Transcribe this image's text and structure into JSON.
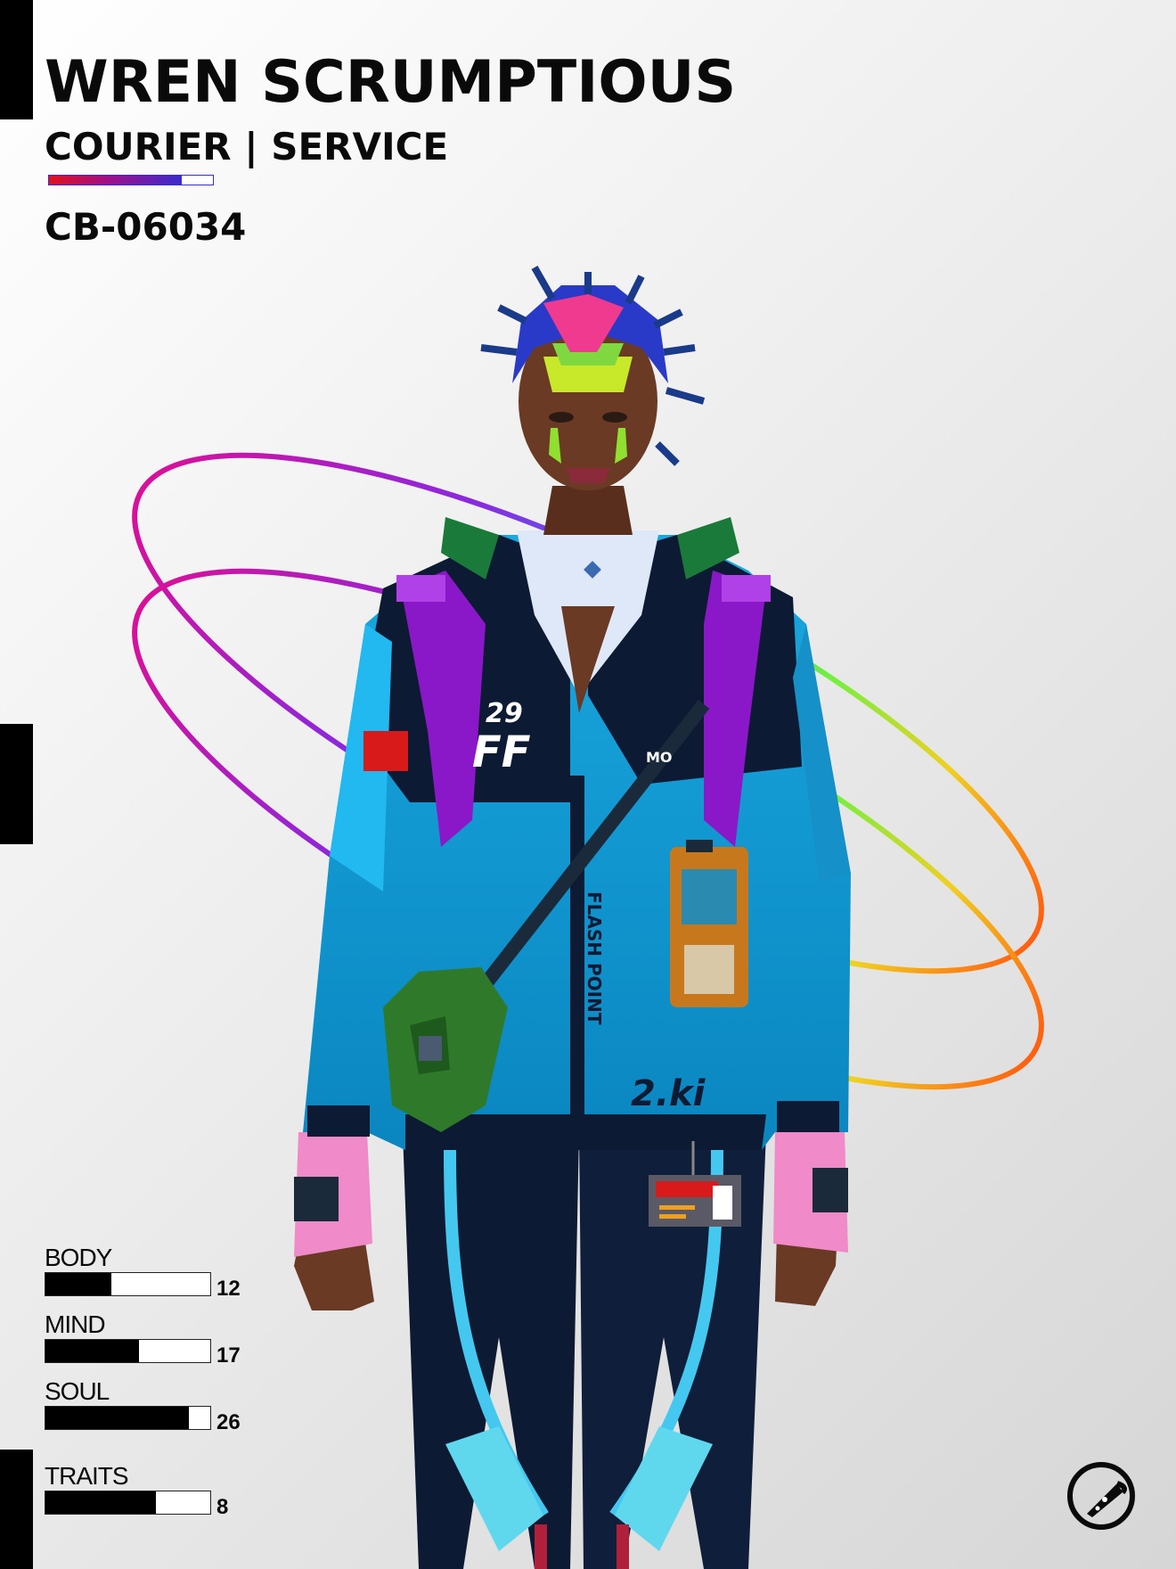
{
  "card": {
    "name": "WREN SCRUMPTIOUS",
    "role": "COURIER | SERVICE",
    "role_meter_fill": 0.81,
    "serial": "CB-06034"
  },
  "stats": [
    {
      "label": "BODY",
      "value": "12",
      "fill": 0.4
    },
    {
      "label": "MIND",
      "value": "17",
      "fill": 0.57
    },
    {
      "label": "SOUL",
      "value": "26",
      "fill": 0.87
    },
    {
      "label": "TRAITS",
      "value": "8",
      "fill": 0.67
    }
  ],
  "artwork": {
    "patches": {
      "chest_left": "FF",
      "chest_num": "29",
      "chest_right": "MO",
      "zipper": "FLASH POINT",
      "pocket": "2.ki"
    }
  },
  "colors": {
    "jacket": "#0a96d0",
    "jacket_dark": "#0d1a33",
    "strap": "#8a18c8",
    "bag": "#2f7a2a",
    "ring_start": "#d8109a",
    "ring_end": "#ff7010"
  },
  "logo": {
    "icon": "pizza-slice-icon"
  }
}
